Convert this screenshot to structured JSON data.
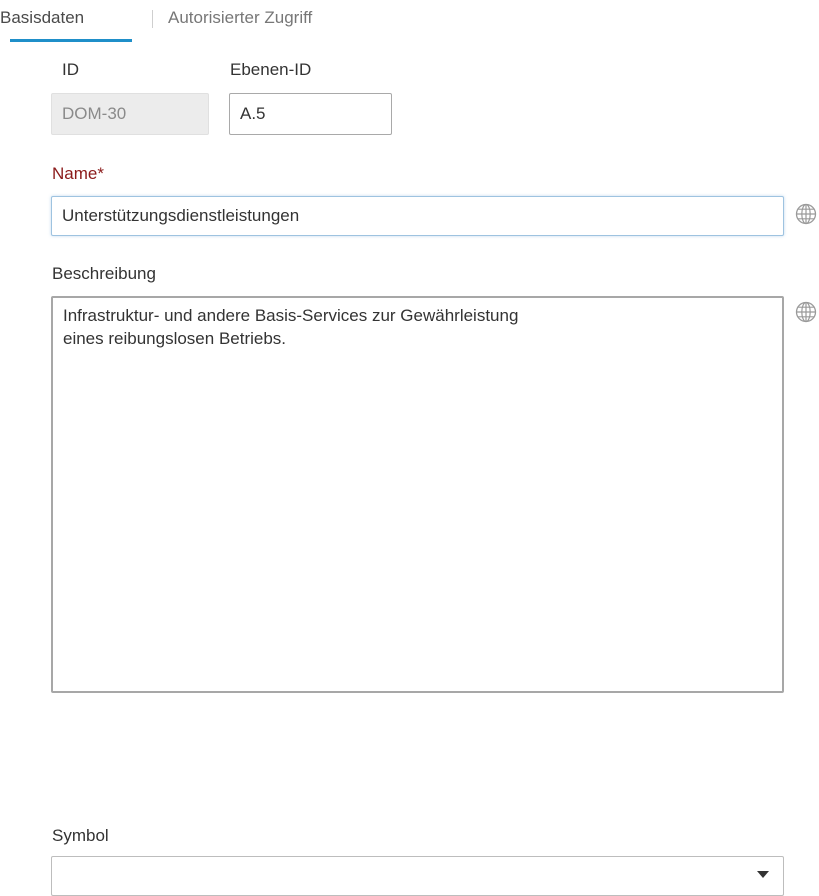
{
  "tabs": [
    {
      "label": "Basisdaten",
      "active": true
    },
    {
      "label": "Autorisierter Zugriff",
      "active": false
    }
  ],
  "fields": {
    "id": {
      "label": "ID",
      "value": "DOM-30",
      "disabled": true
    },
    "level_id": {
      "label": "Ebenen-ID",
      "value": "A.5"
    },
    "name": {
      "label": "Name*",
      "value": "Unterstützungsdienstleistungen"
    },
    "description": {
      "label": "Beschreibung",
      "value": "Infrastruktur- und andere Basis-Services zur Gewährleistung\neines reibungslosen Betriebs."
    },
    "symbol": {
      "label": "Symbol",
      "value": ""
    }
  },
  "icons": {
    "translate_name": "globe-icon",
    "translate_description": "globe-icon",
    "symbol_dropdown": "chevron-down-icon"
  },
  "colors": {
    "accent": "#1f8fc9",
    "required_label": "#8b1a1a",
    "disabled_field": "#ececec"
  }
}
